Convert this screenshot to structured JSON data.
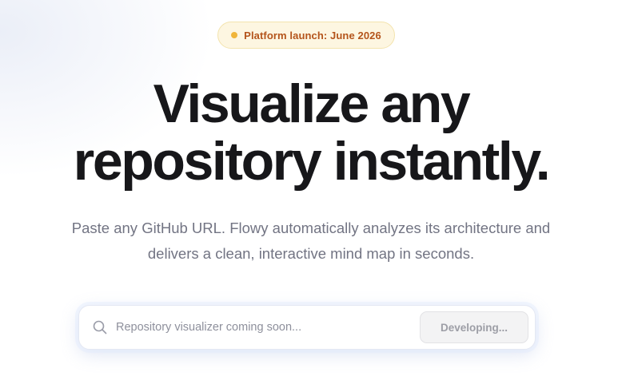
{
  "badge": {
    "text": "Platform launch: June 2026",
    "dot_color": "#f0b53a",
    "text_color": "#b4541b"
  },
  "hero": {
    "title_line1": "Visualize any",
    "title_line2": "repository instantly.",
    "subtitle_line1": "Paste any GitHub URL. Flowy automatically analyzes its architecture and",
    "subtitle_line2": "delivers a clean, interactive mind map in seconds."
  },
  "search": {
    "icon": "search-icon",
    "placeholder": "Repository visualizer coming soon...",
    "button_label": "Developing..."
  }
}
